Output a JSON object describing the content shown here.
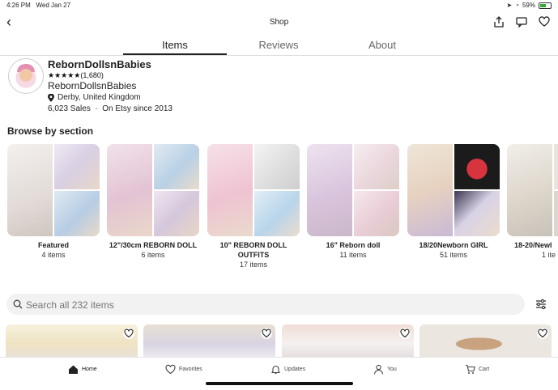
{
  "status": {
    "time": "4:26 PM",
    "date": "Wed Jan 27",
    "battery": "59%"
  },
  "header": {
    "title": "Shop"
  },
  "tabs": [
    {
      "label": "Items"
    },
    {
      "label": "Reviews"
    },
    {
      "label": "About"
    }
  ],
  "shop": {
    "name": "RebornDollsnBabies",
    "rating_stars": "★★★★★",
    "review_count": "(1,680)",
    "owner_name": "RebornDollsnBabies",
    "location": "Derby, United Kingdom",
    "sales_line": "6,023 Sales  ·  On Etsy since 2013"
  },
  "browse": {
    "heading": "Browse by section"
  },
  "sections": [
    {
      "name": "Featured",
      "count": "4 items"
    },
    {
      "name": "12\"/30cm REBORN DOLL",
      "count": "6 items"
    },
    {
      "name": "10\"  REBORN DOLL OUTFITS",
      "count": "17 items"
    },
    {
      "name": "16\" Reborn doll",
      "count": "11 items"
    },
    {
      "name": "18/20Newborn GIRL",
      "count": "51 items"
    },
    {
      "name": "18-20/Newl",
      "count": "1 ite"
    }
  ],
  "search": {
    "placeholder": "Search all 232 items"
  },
  "bottom_nav": [
    {
      "label": "Home"
    },
    {
      "label": "Favorites"
    },
    {
      "label": "Updates"
    },
    {
      "label": "You"
    },
    {
      "label": "Cart"
    }
  ],
  "colors": {
    "accent": "#222222",
    "star": "#111111",
    "search_bg": "#f2f2f2"
  }
}
